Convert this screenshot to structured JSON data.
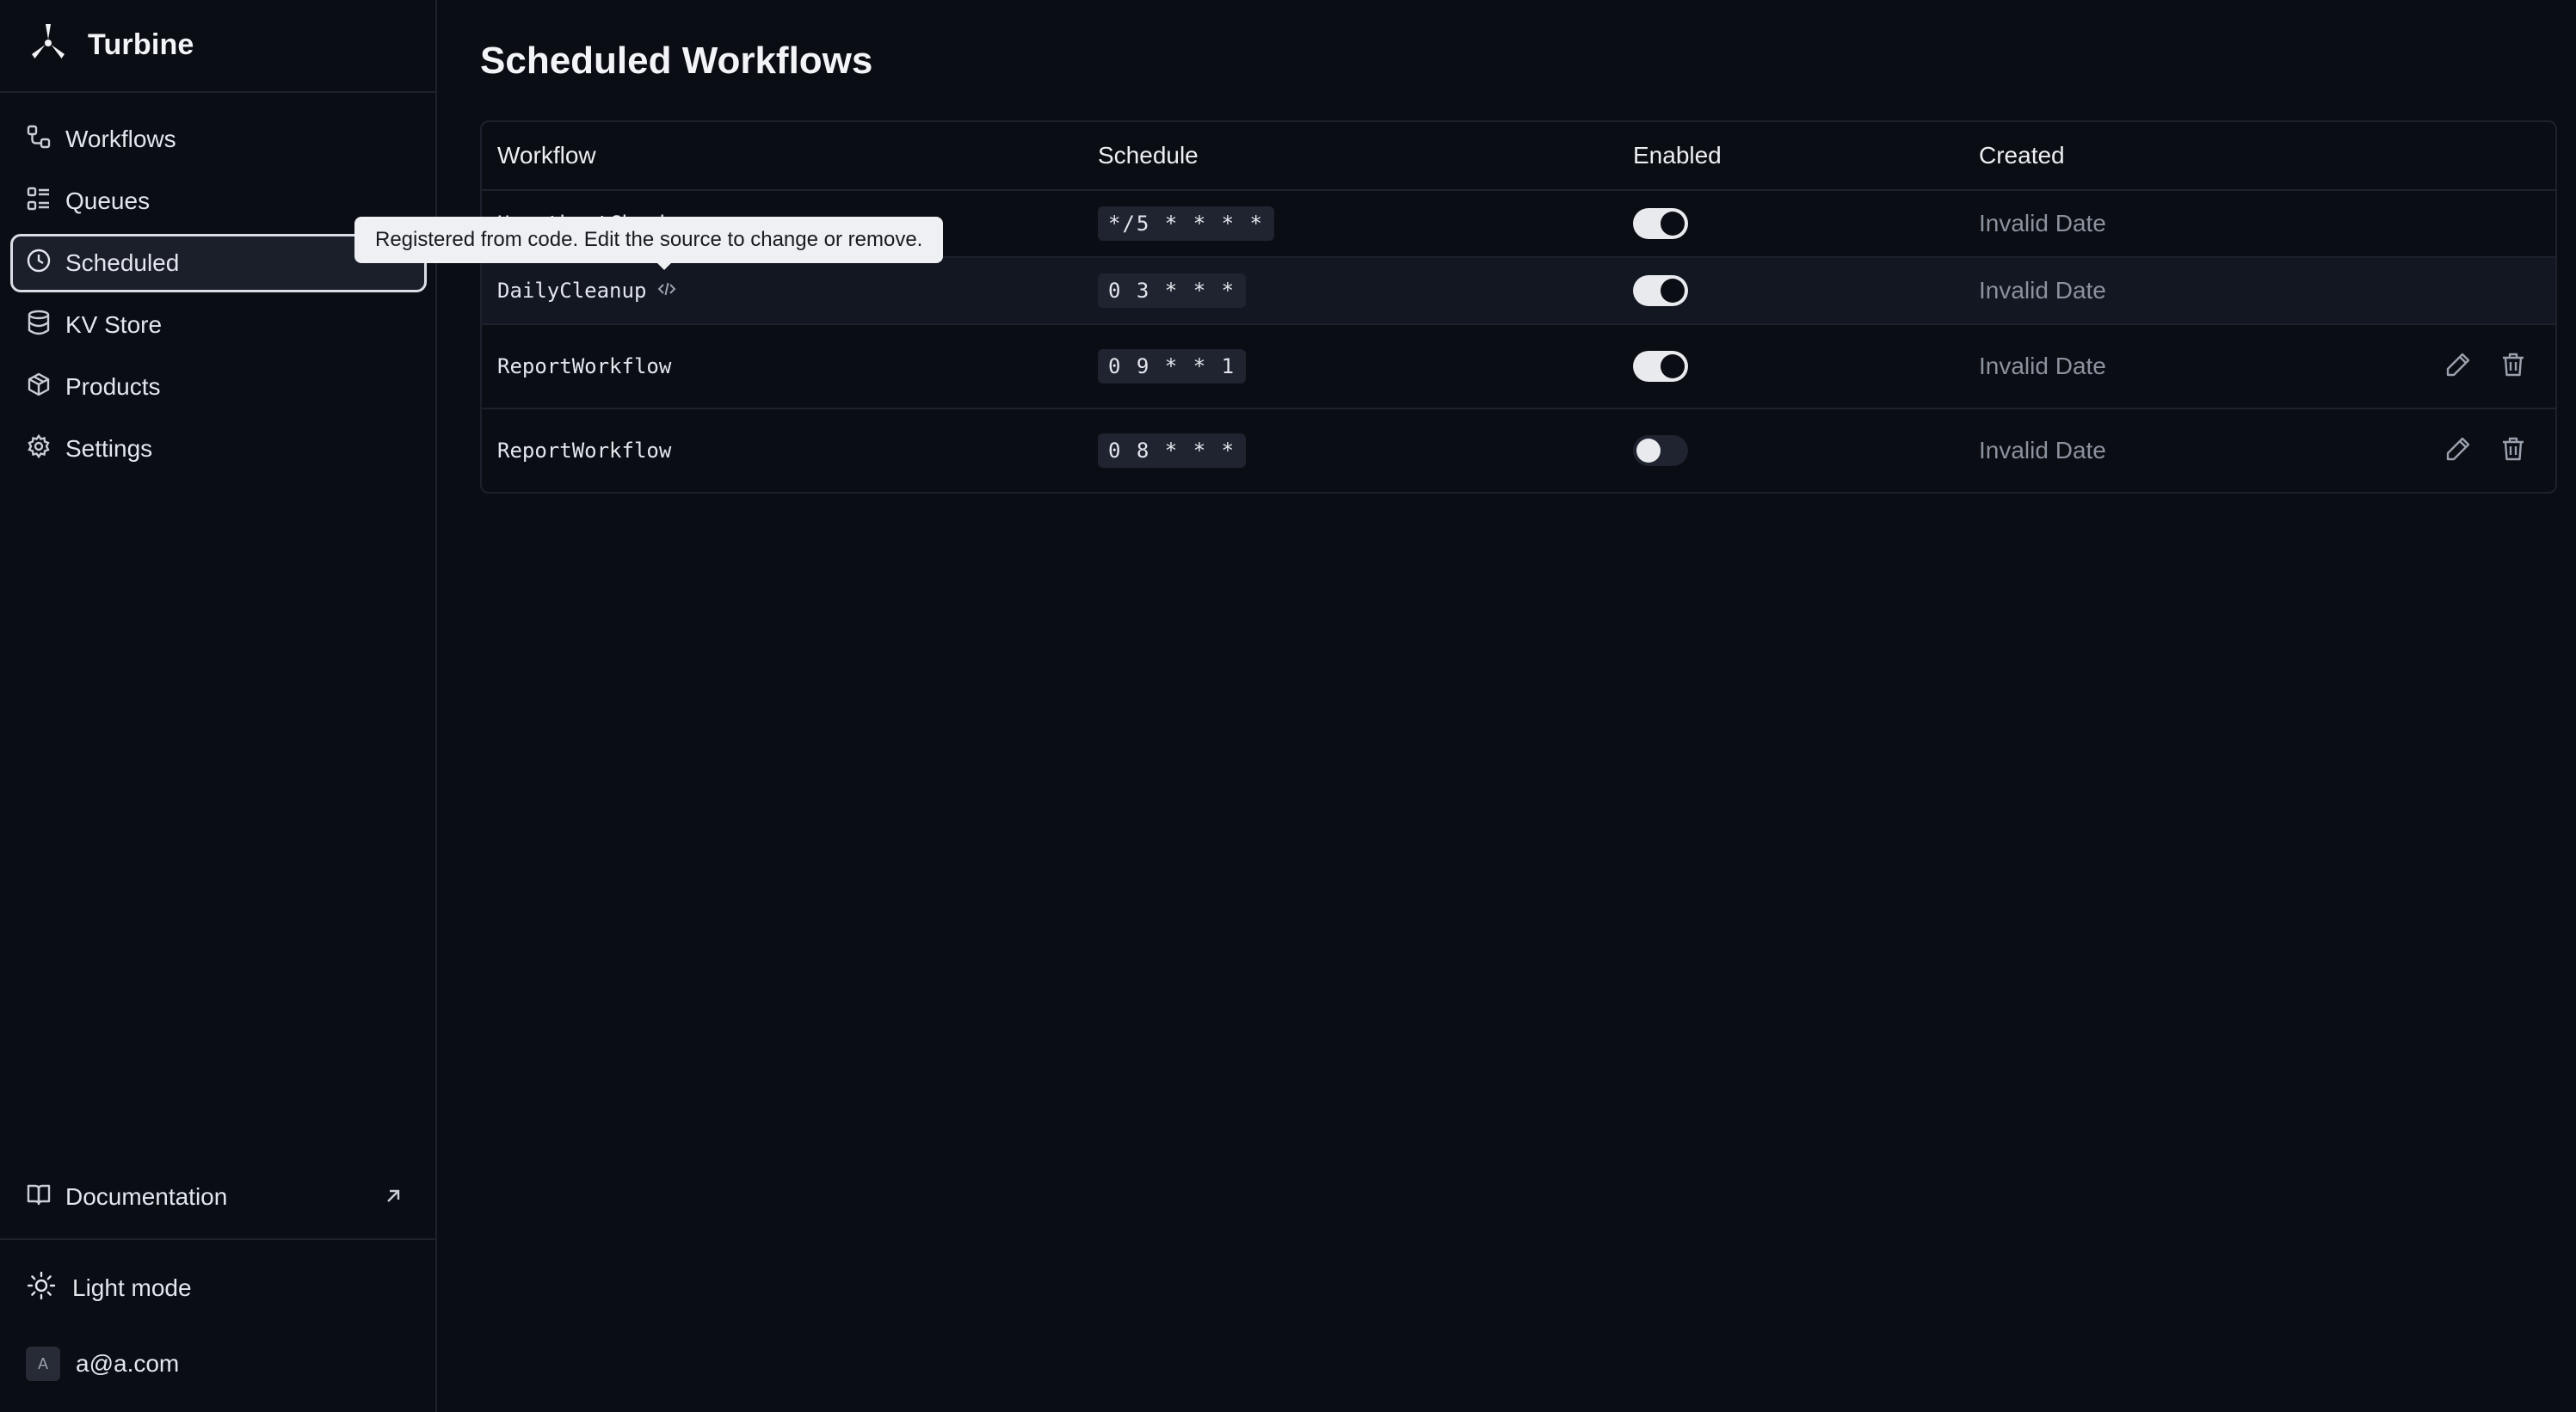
{
  "app": {
    "name": "Turbine"
  },
  "sidebar": {
    "items": [
      {
        "label": "Workflows",
        "icon": "workflow-icon",
        "active": false
      },
      {
        "label": "Queues",
        "icon": "list-icon",
        "active": false
      },
      {
        "label": "Scheduled",
        "icon": "clock-icon",
        "active": true
      },
      {
        "label": "KV Store",
        "icon": "database-icon",
        "active": false
      },
      {
        "label": "Products",
        "icon": "package-icon",
        "active": false
      },
      {
        "label": "Settings",
        "icon": "gear-icon",
        "active": false
      }
    ],
    "documentation": "Documentation",
    "theme_toggle": "Light mode",
    "user": {
      "initial": "A",
      "email": "a@a.com"
    }
  },
  "page": {
    "title": "Scheduled Workflows"
  },
  "table": {
    "columns": [
      "Workflow",
      "Schedule",
      "Enabled",
      "Created"
    ],
    "rows": [
      {
        "workflow": "HeartbeatCheck",
        "schedule": "*/5 * * * *",
        "enabled": true,
        "created": "Invalid Date",
        "from_code": true
      },
      {
        "workflow": "DailyCleanup",
        "schedule": "0 3 * * *",
        "enabled": true,
        "created": "Invalid Date",
        "from_code": true
      },
      {
        "workflow": "ReportWorkflow",
        "schedule": "0 9 * * 1",
        "enabled": true,
        "created": "Invalid Date",
        "from_code": false
      },
      {
        "workflow": "ReportWorkflow",
        "schedule": "0 8 * * *",
        "enabled": false,
        "created": "Invalid Date",
        "from_code": false
      }
    ]
  },
  "tooltip": {
    "text": "Registered from code. Edit the source to change or remove."
  },
  "colors": {
    "background": "#0a0d14",
    "border": "#1c212b",
    "muted": "#8c929d",
    "toggle_on": "#e8eaee"
  }
}
